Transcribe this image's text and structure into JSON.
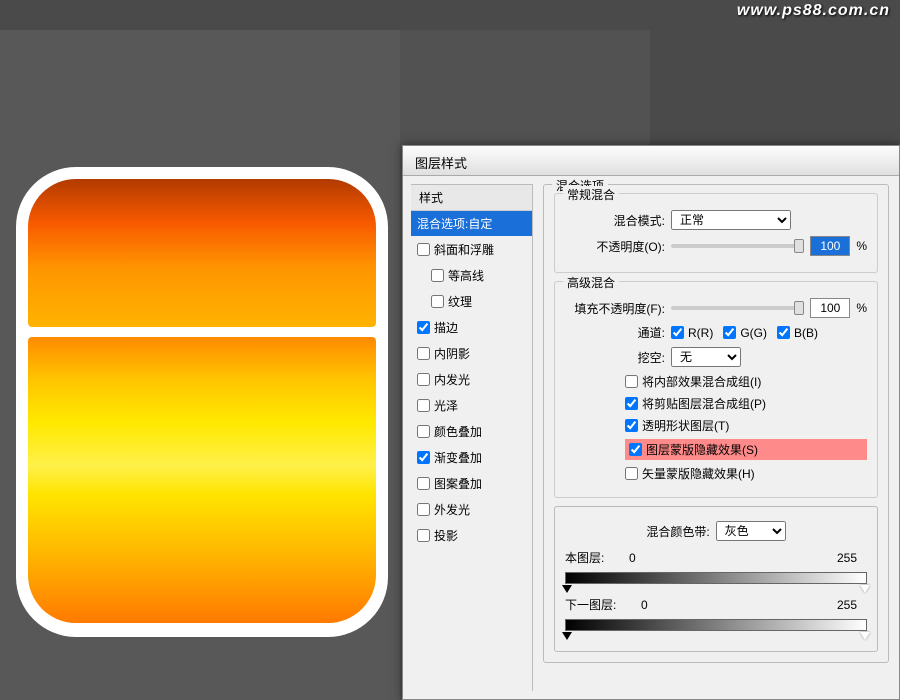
{
  "watermark": "www.ps88.com.cn",
  "dialog": {
    "title": "图层样式"
  },
  "styles": {
    "header": "样式",
    "items": [
      {
        "label": "混合选项:自定",
        "checked": null,
        "selected": true
      },
      {
        "label": "斜面和浮雕",
        "checked": false
      },
      {
        "label": "等高线",
        "checked": false,
        "indent": true
      },
      {
        "label": "纹理",
        "checked": false,
        "indent": true
      },
      {
        "label": "描边",
        "checked": true
      },
      {
        "label": "内阴影",
        "checked": false
      },
      {
        "label": "内发光",
        "checked": false
      },
      {
        "label": "光泽",
        "checked": false
      },
      {
        "label": "颜色叠加",
        "checked": false
      },
      {
        "label": "渐变叠加",
        "checked": true
      },
      {
        "label": "图案叠加",
        "checked": false
      },
      {
        "label": "外发光",
        "checked": false
      },
      {
        "label": "投影",
        "checked": false
      }
    ]
  },
  "blend": {
    "group_title": "混合选项",
    "general": {
      "title": "常规混合",
      "mode_label": "混合模式:",
      "mode_value": "正常",
      "opacity_label": "不透明度(O):",
      "opacity_value": "100",
      "pct": "%"
    },
    "advanced": {
      "title": "高级混合",
      "fill_label": "填充不透明度(F):",
      "fill_value": "100",
      "pct": "%",
      "channel_label": "通道:",
      "r": "R(R)",
      "g": "G(G)",
      "b": "B(B)",
      "knockout_label": "挖空:",
      "knockout_value": "无",
      "opt1": "将内部效果混合成组(I)",
      "opt2": "将剪贴图层混合成组(P)",
      "opt3": "透明形状图层(T)",
      "opt4": "图层蒙版隐藏效果(S)",
      "opt5": "矢量蒙版隐藏效果(H)"
    },
    "blendif": {
      "label": "混合颜色带:",
      "value": "灰色",
      "this_label": "本图层:",
      "this_low": "0",
      "this_high": "255",
      "under_label": "下一图层:",
      "under_low": "0",
      "under_high": "255"
    }
  }
}
